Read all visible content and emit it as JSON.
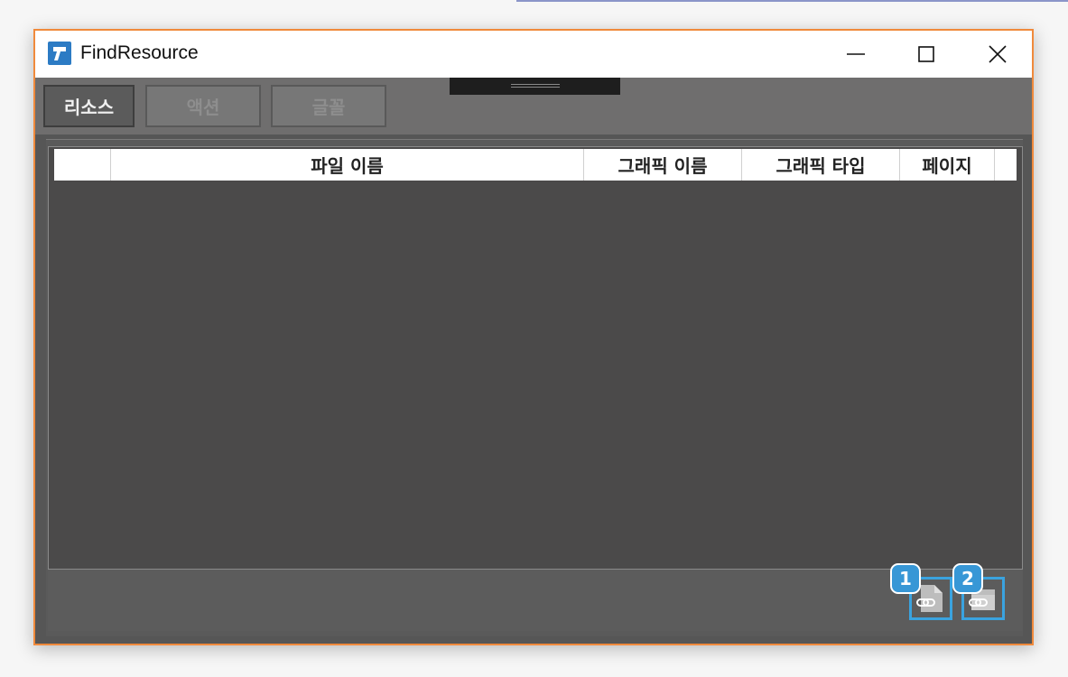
{
  "window": {
    "title": "FindResource",
    "controls": [
      "minimize-icon",
      "maximize-icon",
      "close-icon"
    ]
  },
  "tabs": [
    {
      "label": "리소스",
      "active": true
    },
    {
      "label": "액션",
      "active": false
    },
    {
      "label": "글꼴",
      "active": false
    }
  ],
  "table": {
    "columns": [
      "",
      "파일 이름",
      "그래픽 이름",
      "그래픽 타입",
      "페이지"
    ],
    "rows": []
  },
  "bottom_buttons": [
    {
      "icon": "file-link-icon",
      "badge": "1"
    },
    {
      "icon": "folder-link-icon",
      "badge": "2"
    }
  ],
  "colors": {
    "window_border": "#f08a3c",
    "highlight": "#3aa3df",
    "badge": "#3797d6"
  }
}
